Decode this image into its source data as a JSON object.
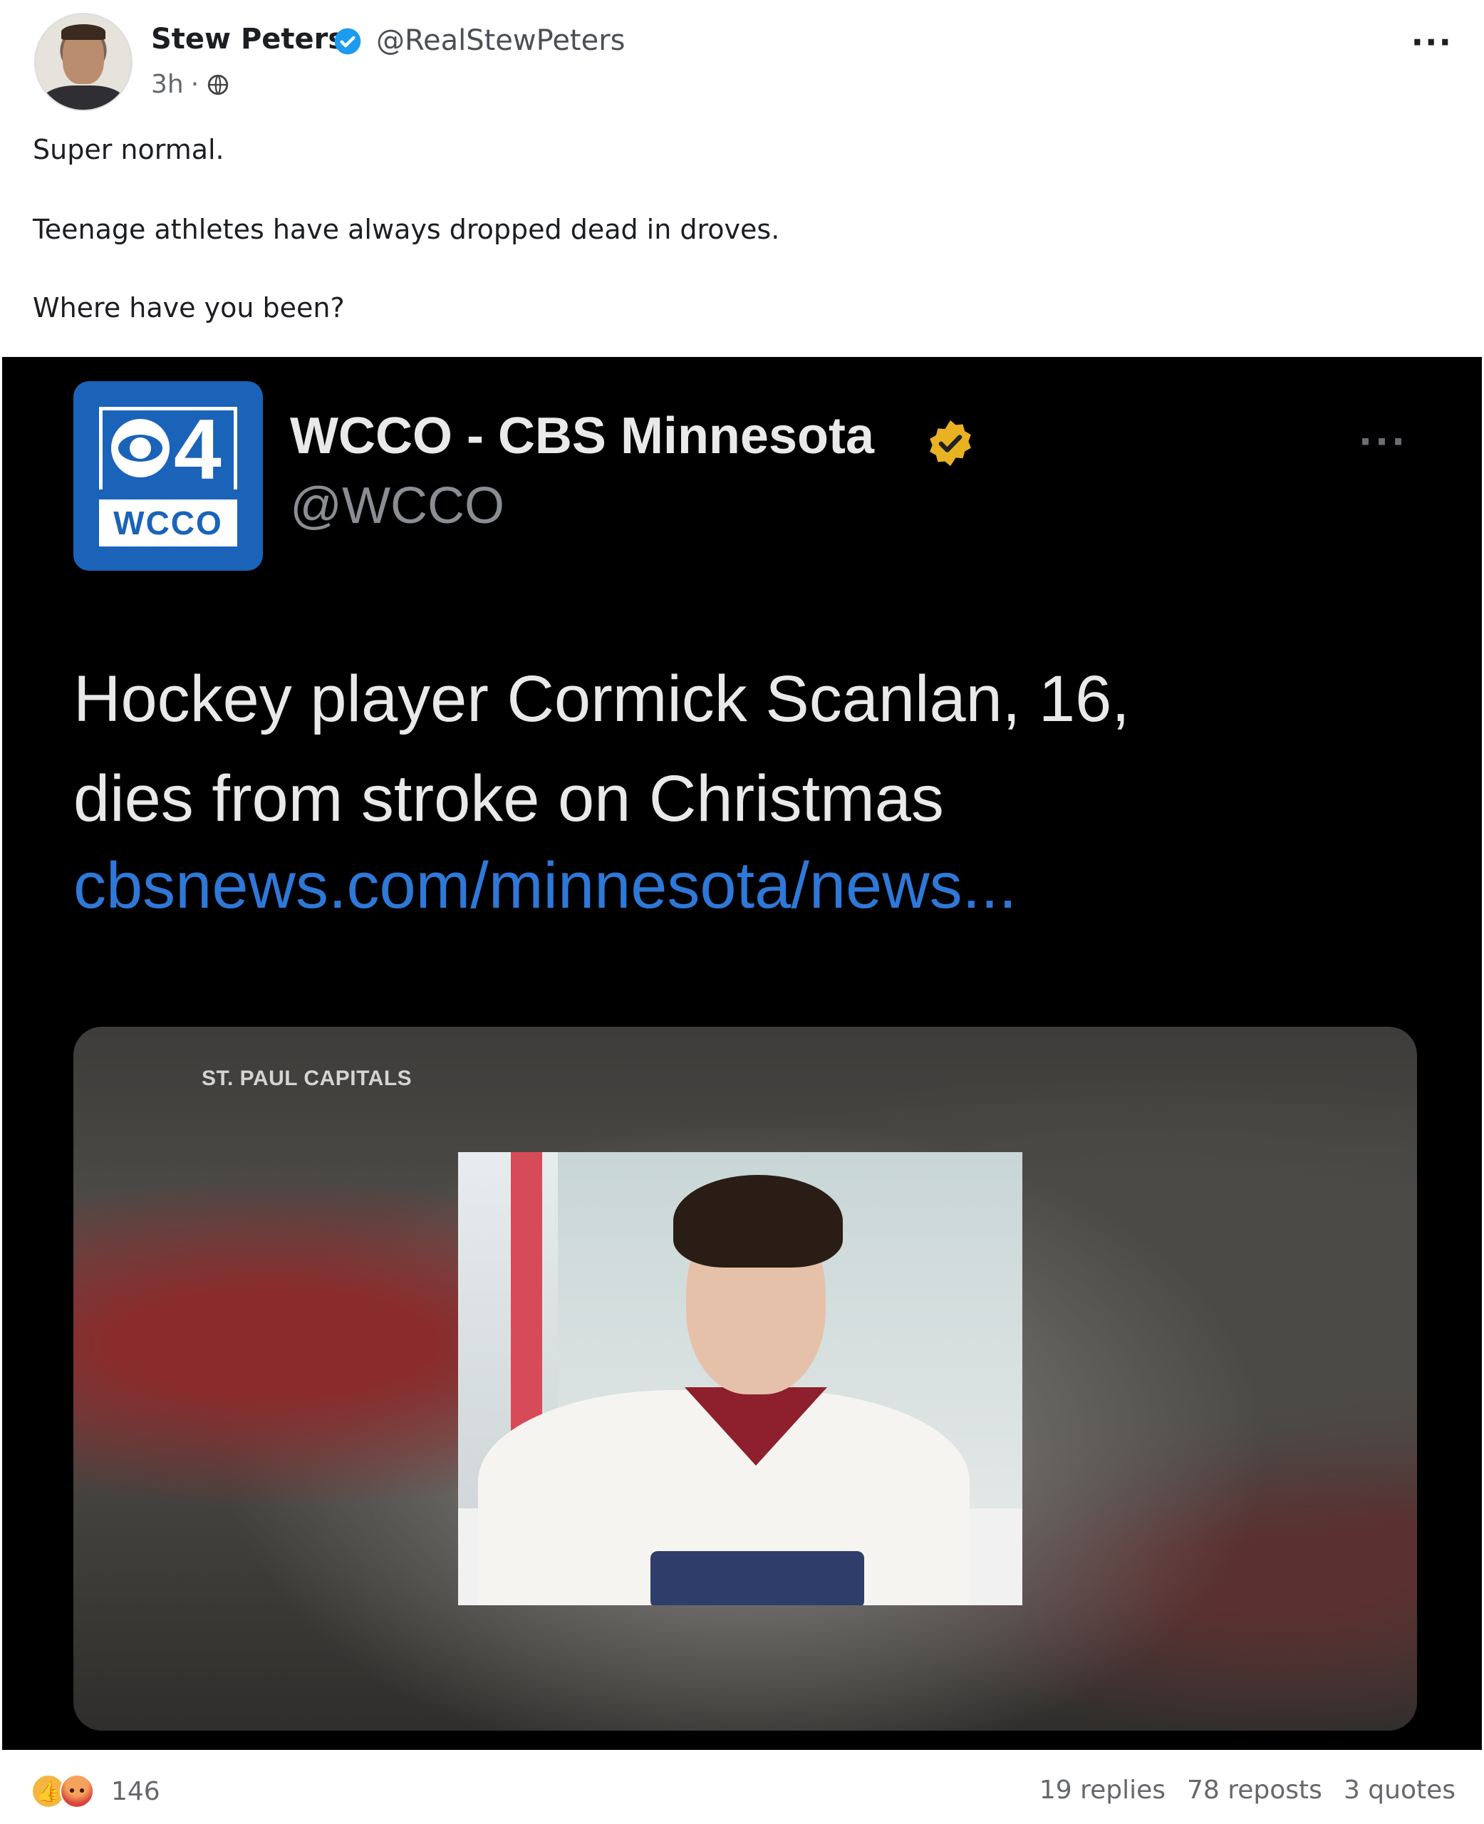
{
  "post": {
    "author_name": "Stew Peters",
    "author_handle": "@RealStewPeters",
    "time": "3h",
    "separator": "·",
    "more_menu": "···",
    "text_lines": [
      "Super normal.",
      "Teenage athletes have always dropped dead in droves.",
      "Where have you been?"
    ]
  },
  "embed": {
    "logo_number": "4",
    "logo_text": "WCCO",
    "account_name": "WCCO - CBS Minnesota",
    "account_handle": "@WCCO",
    "more_menu": "···",
    "headline_line1": "Hockey player Cormick Scanlan, 16,",
    "headline_line2": "dies from stroke on Christmas",
    "link": "cbsnews.com/minnesota/news...",
    "photo_caption": "ST. PAUL CAPITALS"
  },
  "footer": {
    "reaction_count": "146",
    "replies": "19 replies",
    "reposts": "78 reposts",
    "quotes": "3 quotes"
  },
  "colors": {
    "verified_blue": "#1d9bf0",
    "wcco_blue": "#1a63b9",
    "gold_verified": "#e8b223",
    "link_blue": "#2e78d8"
  }
}
